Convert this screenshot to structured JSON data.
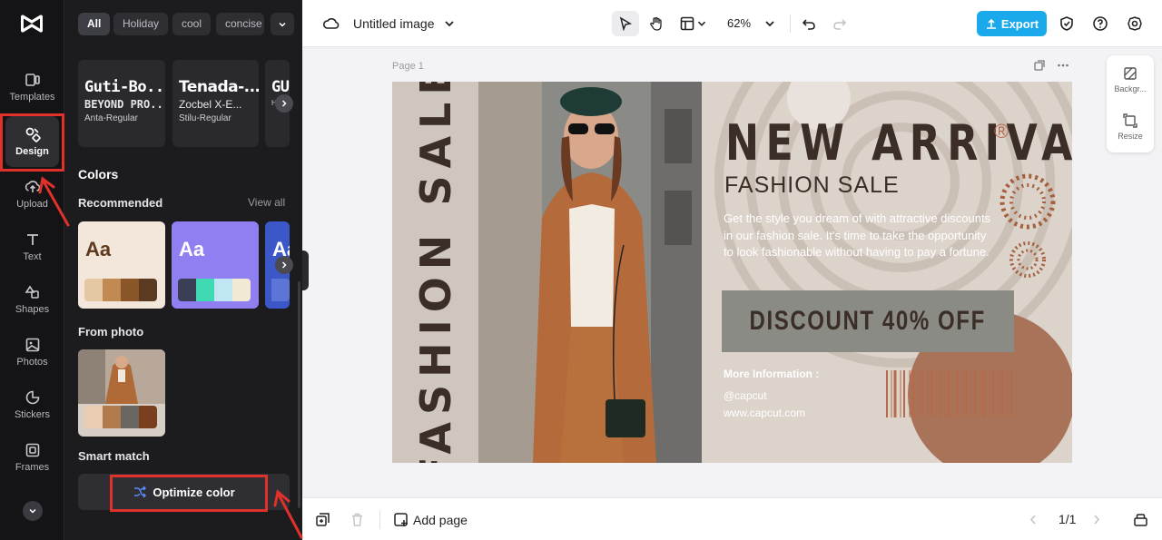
{
  "rail": {
    "items": [
      {
        "label": "Templates",
        "icon": "templates-icon"
      },
      {
        "label": "Design",
        "icon": "design-icon"
      },
      {
        "label": "Upload",
        "icon": "upload-icon"
      },
      {
        "label": "Text",
        "icon": "text-icon"
      },
      {
        "label": "Shapes",
        "icon": "shapes-icon"
      },
      {
        "label": "Photos",
        "icon": "photos-icon"
      },
      {
        "label": "Stickers",
        "icon": "stickers-icon"
      },
      {
        "label": "Frames",
        "icon": "frames-icon"
      }
    ]
  },
  "panel": {
    "chips": [
      "All",
      "Holiday",
      "cool",
      "concise"
    ],
    "fonts": [
      {
        "title": "Guti-Bo...",
        "sub": "BEYOND PRO...",
        "name": "Anta-Regular"
      },
      {
        "title": "Tenada-...",
        "sub": "Zocbel X-E...",
        "name": "Stilu-Regular"
      },
      {
        "title": "GU",
        "sub": "",
        "name": "Ham"
      }
    ],
    "colors_title": "Colors",
    "recommended": "Recommended",
    "view_all": "View all",
    "aa": "Aa",
    "palettes": [
      {
        "bg": "#f3e6db",
        "text": "#5e3a1e",
        "swatches": [
          "#e4c7a3",
          "#c08a52",
          "#8a5628",
          "#5b3a22"
        ]
      },
      {
        "bg": "#8f7ff1",
        "text": "#ffffff",
        "swatches": [
          "#3b3f56",
          "#3fd9b3",
          "#bfe6f2",
          "#f1e9d4"
        ]
      },
      {
        "bg": "#3c58c8",
        "text": "#ffffff",
        "swatches": [
          "#5c76d8"
        ]
      }
    ],
    "from_photo": "From photo",
    "photo_swatches": [
      "#e9cdb2",
      "#b27b4e",
      "#6a6762",
      "#7a3f1e"
    ],
    "smart_match": "Smart match",
    "optimize": "Optimize color"
  },
  "topbar": {
    "title": "Untitled image",
    "zoom": "62%",
    "export": "Export"
  },
  "canvas": {
    "page_label": "Page 1",
    "vertical_text": "FASHION SALE",
    "title": "NEW ARRIVAL",
    "reg": "®",
    "subtitle": "FASHION SALE",
    "body": "Get the style you dream of with attractive discounts in our fashion sale. It's time to take the opportunity to look fashionable without having to pay a fortune.",
    "discount": "DISCOUNT 40% OFF",
    "more_info": "More Information :",
    "handle": "@capcut",
    "website": "www.capcut.com"
  },
  "rtools": {
    "background": "Backgr...",
    "resize": "Resize"
  },
  "bottombar": {
    "add_page": "Add page",
    "pages": "1/1"
  },
  "colors": {
    "accent": "#1aa9ea",
    "annotation": "#e0312b",
    "design_dark": "#3a2e27",
    "design_rust": "#b46b4c"
  }
}
